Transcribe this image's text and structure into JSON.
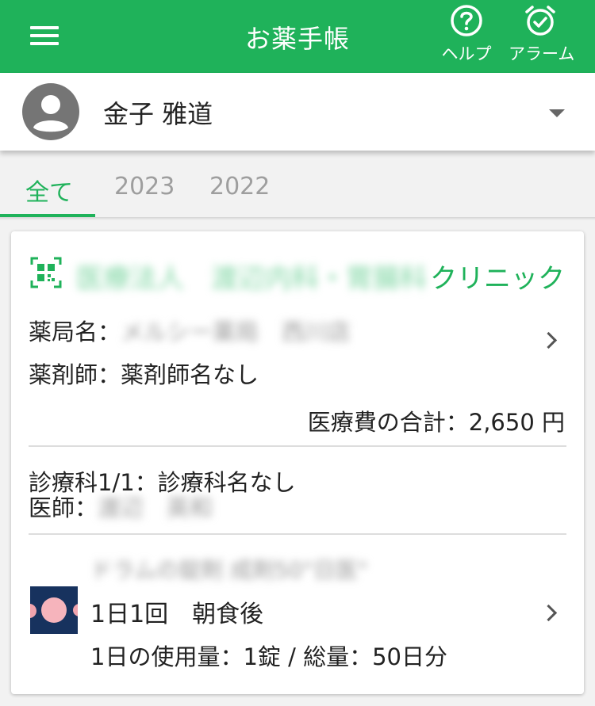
{
  "header": {
    "title": "お薬手帳",
    "help_label": "ヘルプ",
    "alarm_label": "アラーム"
  },
  "account": {
    "name": "金子 雅道"
  },
  "tabs": [
    {
      "label": "全て",
      "active": true
    },
    {
      "label": "2023",
      "active": false
    },
    {
      "label": "2022",
      "active": false
    }
  ],
  "record": {
    "clinic_blurred": "医療法人　渡辺内科・胃腸科",
    "clinic_suffix": "クリニック",
    "pharmacy_label": "薬局名：",
    "pharmacy_blurred": "メルシー薬局　西川店",
    "pharmacist_text": "薬剤師：薬剤師名なし",
    "total_text": "医療費の合計：2,650 円",
    "department_text": "診療科1/1：診療科名なし",
    "doctor_label": "医師：",
    "doctor_blurred": "渡辺　英和",
    "drug": {
      "name_blurred": "ドラムの錠剤 成剤50\"日医\"",
      "dosage": "1日1回　朝食後",
      "usage": "1日の使用量：1錠 / 総量：50日分"
    }
  },
  "colors": {
    "accent": "#1fb25a",
    "pill_bg": "#17325e",
    "pill": "#f0a3ad"
  }
}
